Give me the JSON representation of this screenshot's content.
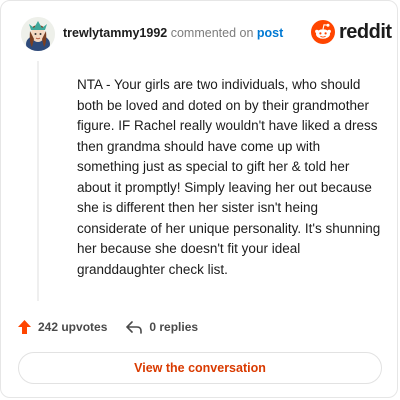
{
  "header": {
    "username": "trewlytammy1992",
    "action_text": "commented on",
    "post_link": "post"
  },
  "brand": {
    "logo_text": "reddit",
    "logo_color": "#ff4500"
  },
  "comment": {
    "text": "NTA - Your girls are two individuals, who should both be loved and doted on by their grandmother figure. IF Rachel really wouldn't have liked a dress then grandma should have come up with something just as special to gift her & told her about it promptly! Simply leaving her out because she is different then her sister isn't heing considerate of her unique personality. It's shunning her because she doesn't fit your ideal granddaughter check list."
  },
  "stats": {
    "upvotes": "242 upvotes",
    "replies": "0 replies",
    "upvote_icon": "upvote-arrow-icon",
    "reply_icon": "reply-arrow-icon"
  },
  "cta": {
    "label": "View the conversation",
    "color": "#d93a00"
  }
}
